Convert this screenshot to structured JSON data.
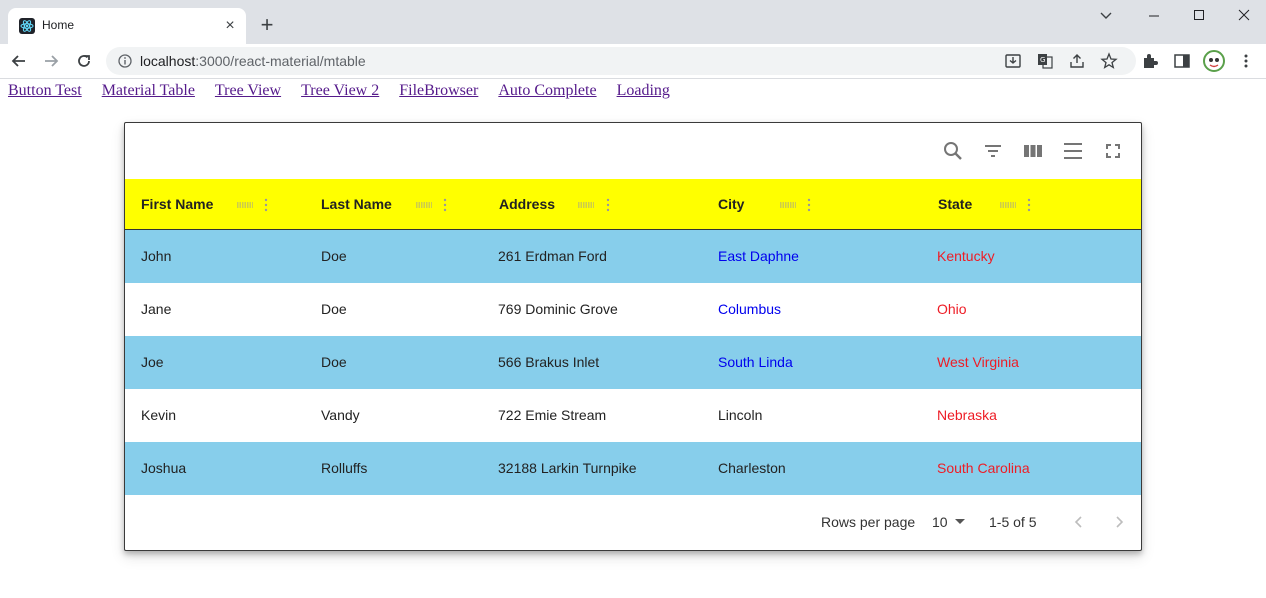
{
  "browser": {
    "tab_title": "Home",
    "url_host": "localhost",
    "url_path": ":3000/react-material/mtable",
    "new_tab_glyph": "+",
    "close_glyph": "×"
  },
  "nav": {
    "links": [
      "Button Test",
      "Material Table",
      "Tree View",
      "Tree View 2",
      "FileBrowser",
      "Auto Complete",
      "Loading"
    ]
  },
  "table": {
    "toolbar_icons": [
      "search-icon",
      "filter-icon",
      "view-column-icon",
      "menu-icon",
      "fullscreen-icon"
    ],
    "columns": [
      "First Name",
      "Last Name",
      "Address",
      "City",
      "State"
    ],
    "rows": [
      [
        "John",
        "Doe",
        "261 Erdman Ford",
        "East Daphne",
        "Kentucky"
      ],
      [
        "Jane",
        "Doe",
        "769 Dominic Grove",
        "Columbus",
        "Ohio"
      ],
      [
        "Joe",
        "Doe",
        "566 Brakus Inlet",
        "South Linda",
        "West Virginia"
      ],
      [
        "Kevin",
        "Vandy",
        "722 Emie Stream",
        "Lincoln",
        "Nebraska"
      ],
      [
        "Joshua",
        "Rolluffs",
        "32188 Larkin Turnpike",
        "Charleston",
        "South Carolina"
      ]
    ],
    "footer": {
      "rows_per_page_label": "Rows per page",
      "rows_per_page_value": "10",
      "range": "1-5 of 5"
    }
  },
  "colors": {
    "header_bg": "#ffff00",
    "odd_row_bg": "#87ceeb",
    "city_blue": "#0000ee",
    "state_red": "#ee1c25"
  }
}
